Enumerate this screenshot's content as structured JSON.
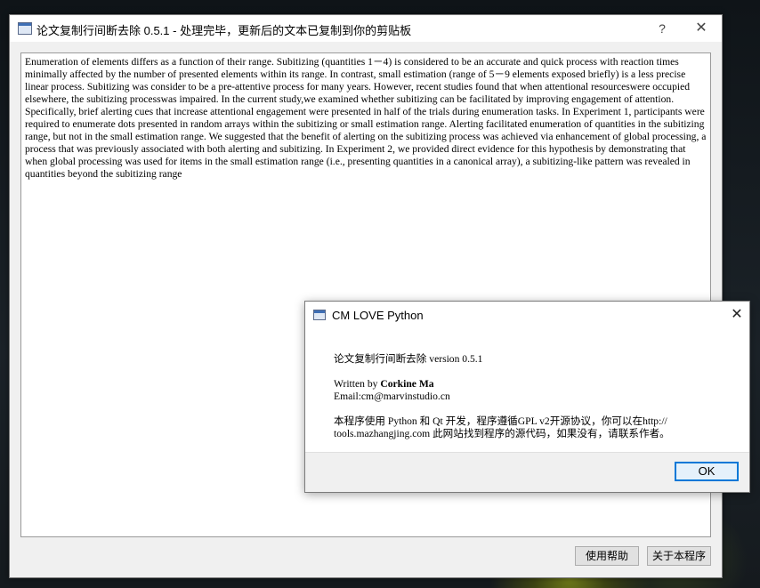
{
  "main_window": {
    "title": "论文复制行间断去除 0.5.1 - 处理完毕，更新后的文本已复制到你的剪贴板",
    "help_glyph": "?",
    "close_glyph": "✕",
    "text_content": "Enumeration of elements differs as a function of their range. Subitizing (quantities 1－4) is considered to be an accurate and quick process with reaction times minimally affected by the number of presented elements within its range. In contrast, small estimation (range of 5－9 elements exposed briefly) is a less precise linear process. Subitizing was consider to be a pre-attentive process for many years. However, recent studies found that when attentional resourceswere occupied elsewhere, the subitizing processwas impaired. In the current study,we examined whether subitizing can be facilitated by improving engagement of attention. Specifically, brief alerting cues that increase attentional engagement were presented in half of the trials during enumeration tasks. In Experiment 1, participants were required to enumerate dots presented in random arrays within the subitizing or small estimation range. Alerting facilitated enumeration of quantities in the subitizing range, but not in the small estimation range. We suggested that the benefit of alerting on the subitizing process was achieved via enhancement of global processing, a process that was previously associated with both alerting and subitizing. In Experiment 2, we provided direct evidence for this hypothesis by demonstrating that when global processing was used for items in the small estimation range (i.e., presenting quantities in a canonical array), a subitizing-like pattern was revealed in quantities beyond the subitizing range",
    "buttons": {
      "help": "使用帮助",
      "about": "关于本程序"
    }
  },
  "about_dialog": {
    "title": "CM LOVE Python",
    "close_glyph": "✕",
    "app_line_prefix": "论文复制行间断去除",
    "app_version": "version 0.5.1",
    "written_by_label": "Written by",
    "author": "Corkine Ma",
    "email": "Email:cm@marvinstudio.cn",
    "license_line_1": "本程序使用 Python 和 Qt 开发，程序遵循GPL v2开源协议，你可以在http://",
    "license_line_2": "tools.mazhangjing.com 此网站找到程序的源代码，如果没有，请联系作者。",
    "ok_label": "OK"
  }
}
